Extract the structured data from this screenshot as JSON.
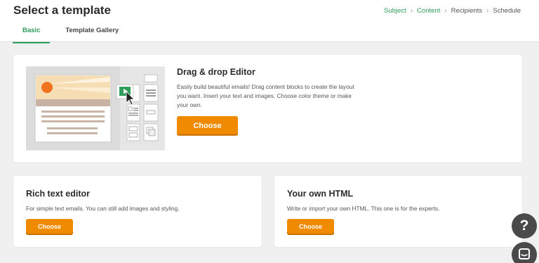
{
  "header": {
    "title": "Select a template",
    "breadcrumb": [
      "Subject",
      "Content",
      "Recipients",
      "Schedule"
    ],
    "tabs": [
      {
        "label": "Basic",
        "active": true
      },
      {
        "label": "Template Gallery",
        "active": false
      }
    ]
  },
  "drag_drop": {
    "title": "Drag & drop Editor",
    "description": "Easily build beautiful emails! Drag content blocks to create the layout you want. Insert your text and images. Choose color theme or make your own.",
    "button": "Choose"
  },
  "rich_text": {
    "title": "Rich text editor",
    "description": "For simple text emails. You can still add images and styling.",
    "button": "Choose"
  },
  "own_html": {
    "title": "Your own HTML",
    "description": "Write or import your own HTML. This one is for the experts.",
    "button": "Choose"
  },
  "help": {
    "label": "?"
  },
  "colors": {
    "accent_green": "#2e9b5a",
    "button_orange": "#f08a00",
    "floating_dark": "#4a4a4a"
  },
  "icons": [
    "chevron-right-icon",
    "question-icon",
    "chat-icon",
    "play-icon",
    "cursor-icon"
  ]
}
